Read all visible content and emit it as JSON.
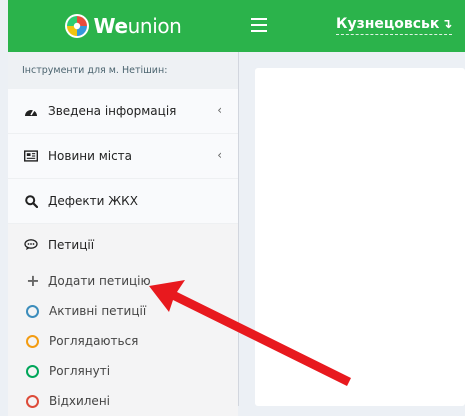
{
  "brand": {
    "name_bold": "We",
    "name_light": "union",
    "color": "#2bb34b"
  },
  "header": {
    "menu_icon": "hamburger-icon",
    "city": "Кузнецовськ",
    "city_arrow": "↴"
  },
  "sidebar": {
    "header": "Інструменти для м. Нетішин:",
    "items": [
      {
        "label": "Зведена інформація",
        "icon": "dashboard-icon",
        "chevron": "‹"
      },
      {
        "label": "Новини міста",
        "icon": "newspaper-icon",
        "chevron": "‹"
      },
      {
        "label": "Дефекти ЖКХ",
        "icon": "search-icon"
      },
      {
        "label": "Петиції",
        "icon": "comment-icon"
      }
    ],
    "petitions_submenu": [
      {
        "label": "Додати петицію",
        "icon": "plus-icon"
      },
      {
        "label": "Активні петиції",
        "icon": "circle-icon",
        "color": "#3c8dbc"
      },
      {
        "label": "Роглядаються",
        "icon": "circle-icon",
        "color": "#f39c12"
      },
      {
        "label": "Роглянуті",
        "icon": "circle-icon",
        "color": "#00a65a"
      },
      {
        "label": "Відхилені",
        "icon": "circle-icon",
        "color": "#dd4b39"
      }
    ]
  },
  "annotation": {
    "color": "#e8191e"
  }
}
